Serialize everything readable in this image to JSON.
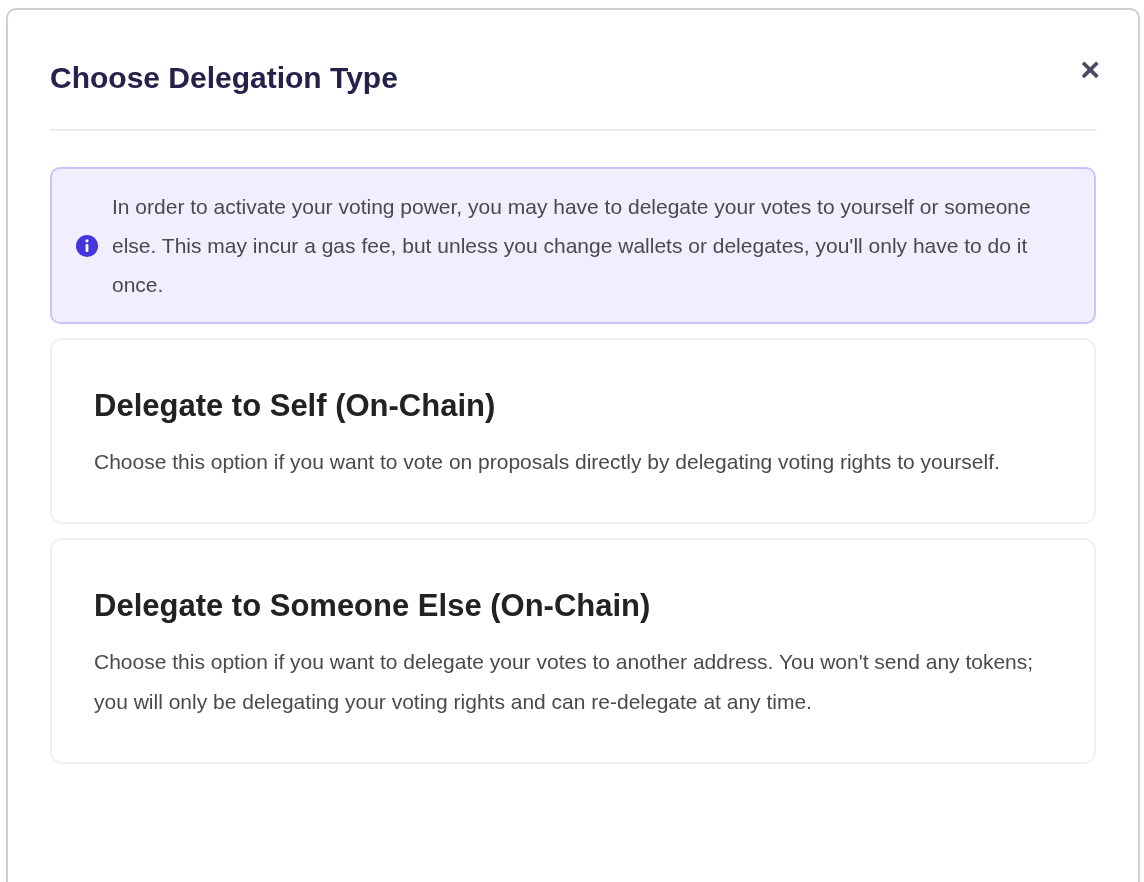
{
  "dialog": {
    "title": "Choose Delegation Type",
    "close": "×"
  },
  "notice": {
    "text": "In order to activate your voting power, you may have to delegate your votes to yourself or someone else. This may incur a gas fee, but unless you change wallets or delegates, you'll only have to do it once."
  },
  "options": [
    {
      "title": "Delegate to Self (On-Chain)",
      "description": "Choose this option if you want to vote on proposals directly by delegating voting rights to yourself."
    },
    {
      "title": "Delegate to Someone Else (On-Chain)",
      "description": "Choose this option if you want to delegate your votes to another address. You won't send any tokens; you will only be delegating your voting rights and can re-delegate at any time."
    }
  ]
}
